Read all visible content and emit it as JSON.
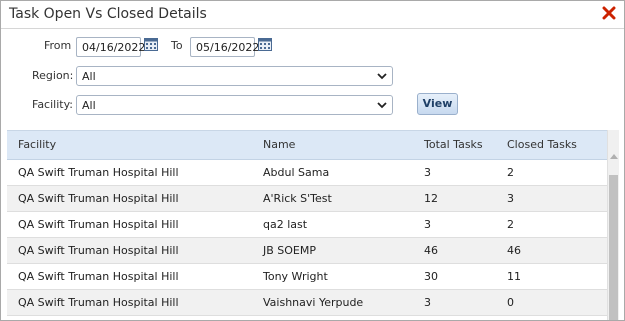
{
  "window": {
    "title": "Task Open Vs Closed Details",
    "close_icon": "close-icon",
    "close_color": "#cc2200"
  },
  "filters": {
    "from_label": "From",
    "from_value": "04/16/2022",
    "to_label": "To",
    "to_value": "05/16/2022",
    "region_label": "Region:",
    "region_value": "All",
    "facility_label": "Facility:",
    "facility_value": "All",
    "view_label": "View",
    "calendar_icon": "calendar-icon"
  },
  "table": {
    "headers": [
      "Facility",
      "Name",
      "Total Tasks",
      "Closed Tasks"
    ],
    "rows": [
      [
        "QA Swift Truman Hospital Hill",
        "Abdul Sama",
        "3",
        "2"
      ],
      [
        "QA Swift Truman Hospital Hill",
        "A'Rick S'Test",
        "12",
        "3"
      ],
      [
        "QA Swift Truman Hospital Hill",
        "qa2 last",
        "3",
        "2"
      ],
      [
        "QA Swift Truman Hospital Hill",
        "JB SOEMP",
        "46",
        "46"
      ],
      [
        "QA Swift Truman Hospital Hill",
        "Tony Wright",
        "30",
        "11"
      ],
      [
        "QA Swift Truman Hospital Hill",
        "Vaishnavi Yerpude",
        "3",
        "0"
      ]
    ]
  },
  "colors": {
    "header_bg": "#dce8f6",
    "alt_row": "#f1f1f1",
    "button_text": "#1f3f66"
  }
}
